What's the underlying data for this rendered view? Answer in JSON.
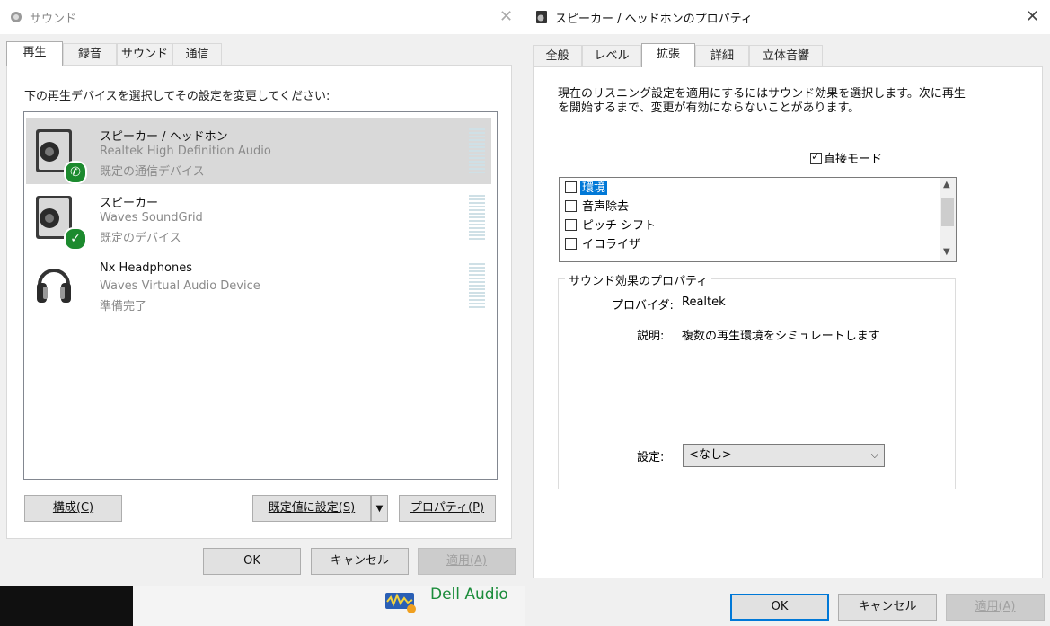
{
  "sound": {
    "title": "サウンド",
    "tabs": [
      {
        "label": "再生"
      },
      {
        "label": "録音"
      },
      {
        "label": "サウンド"
      },
      {
        "label": "通信"
      }
    ],
    "instruction": "下の再生デバイスを選択してその設定を変更してください:",
    "devices": [
      {
        "name": "スピーカー / ヘッドホン",
        "driver": "Realtek High Definition Audio",
        "status": "既定の通信デバイス",
        "icon": "speaker-icon",
        "badge": "phone-icon",
        "selected": true
      },
      {
        "name": "スピーカー",
        "driver": "Waves SoundGrid",
        "status": "既定のデバイス",
        "icon": "speaker-icon",
        "badge": "check-icon",
        "selected": false
      },
      {
        "name": "Nx Headphones",
        "driver": "Waves Virtual Audio Device",
        "status": "準備完了",
        "icon": "headphones-icon",
        "selected": false
      }
    ],
    "buttons": {
      "configure": "構成(C)",
      "set_default": "既定値に設定(S)",
      "properties": "プロパティ(P)",
      "ok": "OK",
      "cancel": "キャンセル",
      "apply": "適用(A)"
    }
  },
  "props": {
    "title": "スピーカー / ヘッドホンのプロパティ",
    "tabs": [
      {
        "label": "全般"
      },
      {
        "label": "レベル"
      },
      {
        "label": "拡張"
      },
      {
        "label": "詳細"
      },
      {
        "label": "立体音響"
      }
    ],
    "description": "現在のリスニング設定を適用にするにはサウンド効果を選択します。次に再生を開始するまで、変更が有効にならないことがあります。",
    "direct_mode": "直接モード",
    "effects": [
      {
        "label": "環境",
        "checked": false,
        "selected": true
      },
      {
        "label": "音声除去",
        "checked": false,
        "selected": false
      },
      {
        "label": "ピッチ シフト",
        "checked": false,
        "selected": false
      },
      {
        "label": "イコライザ",
        "checked": false,
        "selected": false
      }
    ],
    "group_title": "サウンド効果のプロパティ",
    "provider_label": "プロバイダ:",
    "provider_value": "Realtek",
    "desc_label": "説明:",
    "desc_value": "複数の再生環境をシミュレートします",
    "setting_label": "設定:",
    "setting_value": "<なし>",
    "buttons": {
      "ok": "OK",
      "cancel": "キャンセル",
      "apply": "適用(A)"
    }
  },
  "background": {
    "dell_audio": "Dell Audio"
  }
}
